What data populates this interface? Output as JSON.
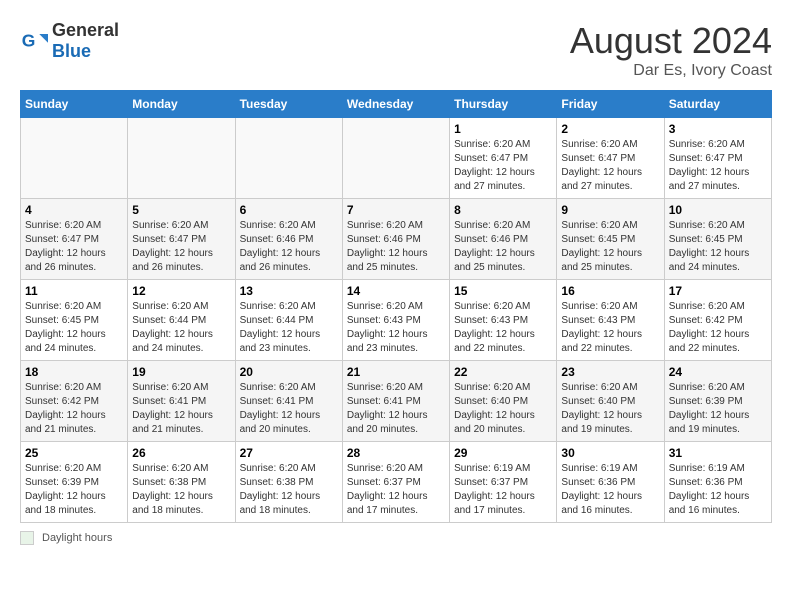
{
  "header": {
    "logo_general": "General",
    "logo_blue": "Blue",
    "month_year": "August 2024",
    "location": "Dar Es, Ivory Coast"
  },
  "weekdays": [
    "Sunday",
    "Monday",
    "Tuesday",
    "Wednesday",
    "Thursday",
    "Friday",
    "Saturday"
  ],
  "footer": {
    "label": "Daylight hours"
  },
  "weeks": [
    [
      {
        "day": "",
        "info": ""
      },
      {
        "day": "",
        "info": ""
      },
      {
        "day": "",
        "info": ""
      },
      {
        "day": "",
        "info": ""
      },
      {
        "day": "1",
        "info": "Sunrise: 6:20 AM\nSunset: 6:47 PM\nDaylight: 12 hours and 27 minutes."
      },
      {
        "day": "2",
        "info": "Sunrise: 6:20 AM\nSunset: 6:47 PM\nDaylight: 12 hours and 27 minutes."
      },
      {
        "day": "3",
        "info": "Sunrise: 6:20 AM\nSunset: 6:47 PM\nDaylight: 12 hours and 27 minutes."
      }
    ],
    [
      {
        "day": "4",
        "info": "Sunrise: 6:20 AM\nSunset: 6:47 PM\nDaylight: 12 hours and 26 minutes."
      },
      {
        "day": "5",
        "info": "Sunrise: 6:20 AM\nSunset: 6:47 PM\nDaylight: 12 hours and 26 minutes."
      },
      {
        "day": "6",
        "info": "Sunrise: 6:20 AM\nSunset: 6:46 PM\nDaylight: 12 hours and 26 minutes."
      },
      {
        "day": "7",
        "info": "Sunrise: 6:20 AM\nSunset: 6:46 PM\nDaylight: 12 hours and 25 minutes."
      },
      {
        "day": "8",
        "info": "Sunrise: 6:20 AM\nSunset: 6:46 PM\nDaylight: 12 hours and 25 minutes."
      },
      {
        "day": "9",
        "info": "Sunrise: 6:20 AM\nSunset: 6:45 PM\nDaylight: 12 hours and 25 minutes."
      },
      {
        "day": "10",
        "info": "Sunrise: 6:20 AM\nSunset: 6:45 PM\nDaylight: 12 hours and 24 minutes."
      }
    ],
    [
      {
        "day": "11",
        "info": "Sunrise: 6:20 AM\nSunset: 6:45 PM\nDaylight: 12 hours and 24 minutes."
      },
      {
        "day": "12",
        "info": "Sunrise: 6:20 AM\nSunset: 6:44 PM\nDaylight: 12 hours and 24 minutes."
      },
      {
        "day": "13",
        "info": "Sunrise: 6:20 AM\nSunset: 6:44 PM\nDaylight: 12 hours and 23 minutes."
      },
      {
        "day": "14",
        "info": "Sunrise: 6:20 AM\nSunset: 6:43 PM\nDaylight: 12 hours and 23 minutes."
      },
      {
        "day": "15",
        "info": "Sunrise: 6:20 AM\nSunset: 6:43 PM\nDaylight: 12 hours and 22 minutes."
      },
      {
        "day": "16",
        "info": "Sunrise: 6:20 AM\nSunset: 6:43 PM\nDaylight: 12 hours and 22 minutes."
      },
      {
        "day": "17",
        "info": "Sunrise: 6:20 AM\nSunset: 6:42 PM\nDaylight: 12 hours and 22 minutes."
      }
    ],
    [
      {
        "day": "18",
        "info": "Sunrise: 6:20 AM\nSunset: 6:42 PM\nDaylight: 12 hours and 21 minutes."
      },
      {
        "day": "19",
        "info": "Sunrise: 6:20 AM\nSunset: 6:41 PM\nDaylight: 12 hours and 21 minutes."
      },
      {
        "day": "20",
        "info": "Sunrise: 6:20 AM\nSunset: 6:41 PM\nDaylight: 12 hours and 20 minutes."
      },
      {
        "day": "21",
        "info": "Sunrise: 6:20 AM\nSunset: 6:41 PM\nDaylight: 12 hours and 20 minutes."
      },
      {
        "day": "22",
        "info": "Sunrise: 6:20 AM\nSunset: 6:40 PM\nDaylight: 12 hours and 20 minutes."
      },
      {
        "day": "23",
        "info": "Sunrise: 6:20 AM\nSunset: 6:40 PM\nDaylight: 12 hours and 19 minutes."
      },
      {
        "day": "24",
        "info": "Sunrise: 6:20 AM\nSunset: 6:39 PM\nDaylight: 12 hours and 19 minutes."
      }
    ],
    [
      {
        "day": "25",
        "info": "Sunrise: 6:20 AM\nSunset: 6:39 PM\nDaylight: 12 hours and 18 minutes."
      },
      {
        "day": "26",
        "info": "Sunrise: 6:20 AM\nSunset: 6:38 PM\nDaylight: 12 hours and 18 minutes."
      },
      {
        "day": "27",
        "info": "Sunrise: 6:20 AM\nSunset: 6:38 PM\nDaylight: 12 hours and 18 minutes."
      },
      {
        "day": "28",
        "info": "Sunrise: 6:20 AM\nSunset: 6:37 PM\nDaylight: 12 hours and 17 minutes."
      },
      {
        "day": "29",
        "info": "Sunrise: 6:19 AM\nSunset: 6:37 PM\nDaylight: 12 hours and 17 minutes."
      },
      {
        "day": "30",
        "info": "Sunrise: 6:19 AM\nSunset: 6:36 PM\nDaylight: 12 hours and 16 minutes."
      },
      {
        "day": "31",
        "info": "Sunrise: 6:19 AM\nSunset: 6:36 PM\nDaylight: 12 hours and 16 minutes."
      }
    ]
  ]
}
